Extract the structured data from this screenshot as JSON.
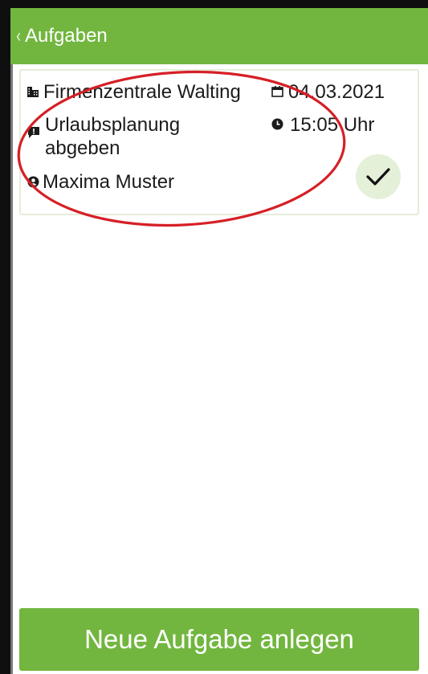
{
  "header": {
    "back_icon": "chevron-left-icon",
    "title": "Aufgaben",
    "color": "#72b63f"
  },
  "task": {
    "location": "Firmenzentrale Walting",
    "date": "04.03.2021",
    "subject": "Urlaubsplanung abgeben",
    "time": "15:05 Uhr",
    "assignee": "Maxima Muster",
    "icons": {
      "location": "building-icon",
      "date": "calendar-icon",
      "subject": "chat-icon",
      "time": "clock-icon",
      "assignee": "person-icon",
      "status": "checkmark-icon"
    },
    "status_done": true
  },
  "annotation": {
    "shape": "red-ellipse",
    "color": "#d61f26"
  },
  "footer": {
    "new_task_label": "Neue Aufgabe anlegen"
  }
}
